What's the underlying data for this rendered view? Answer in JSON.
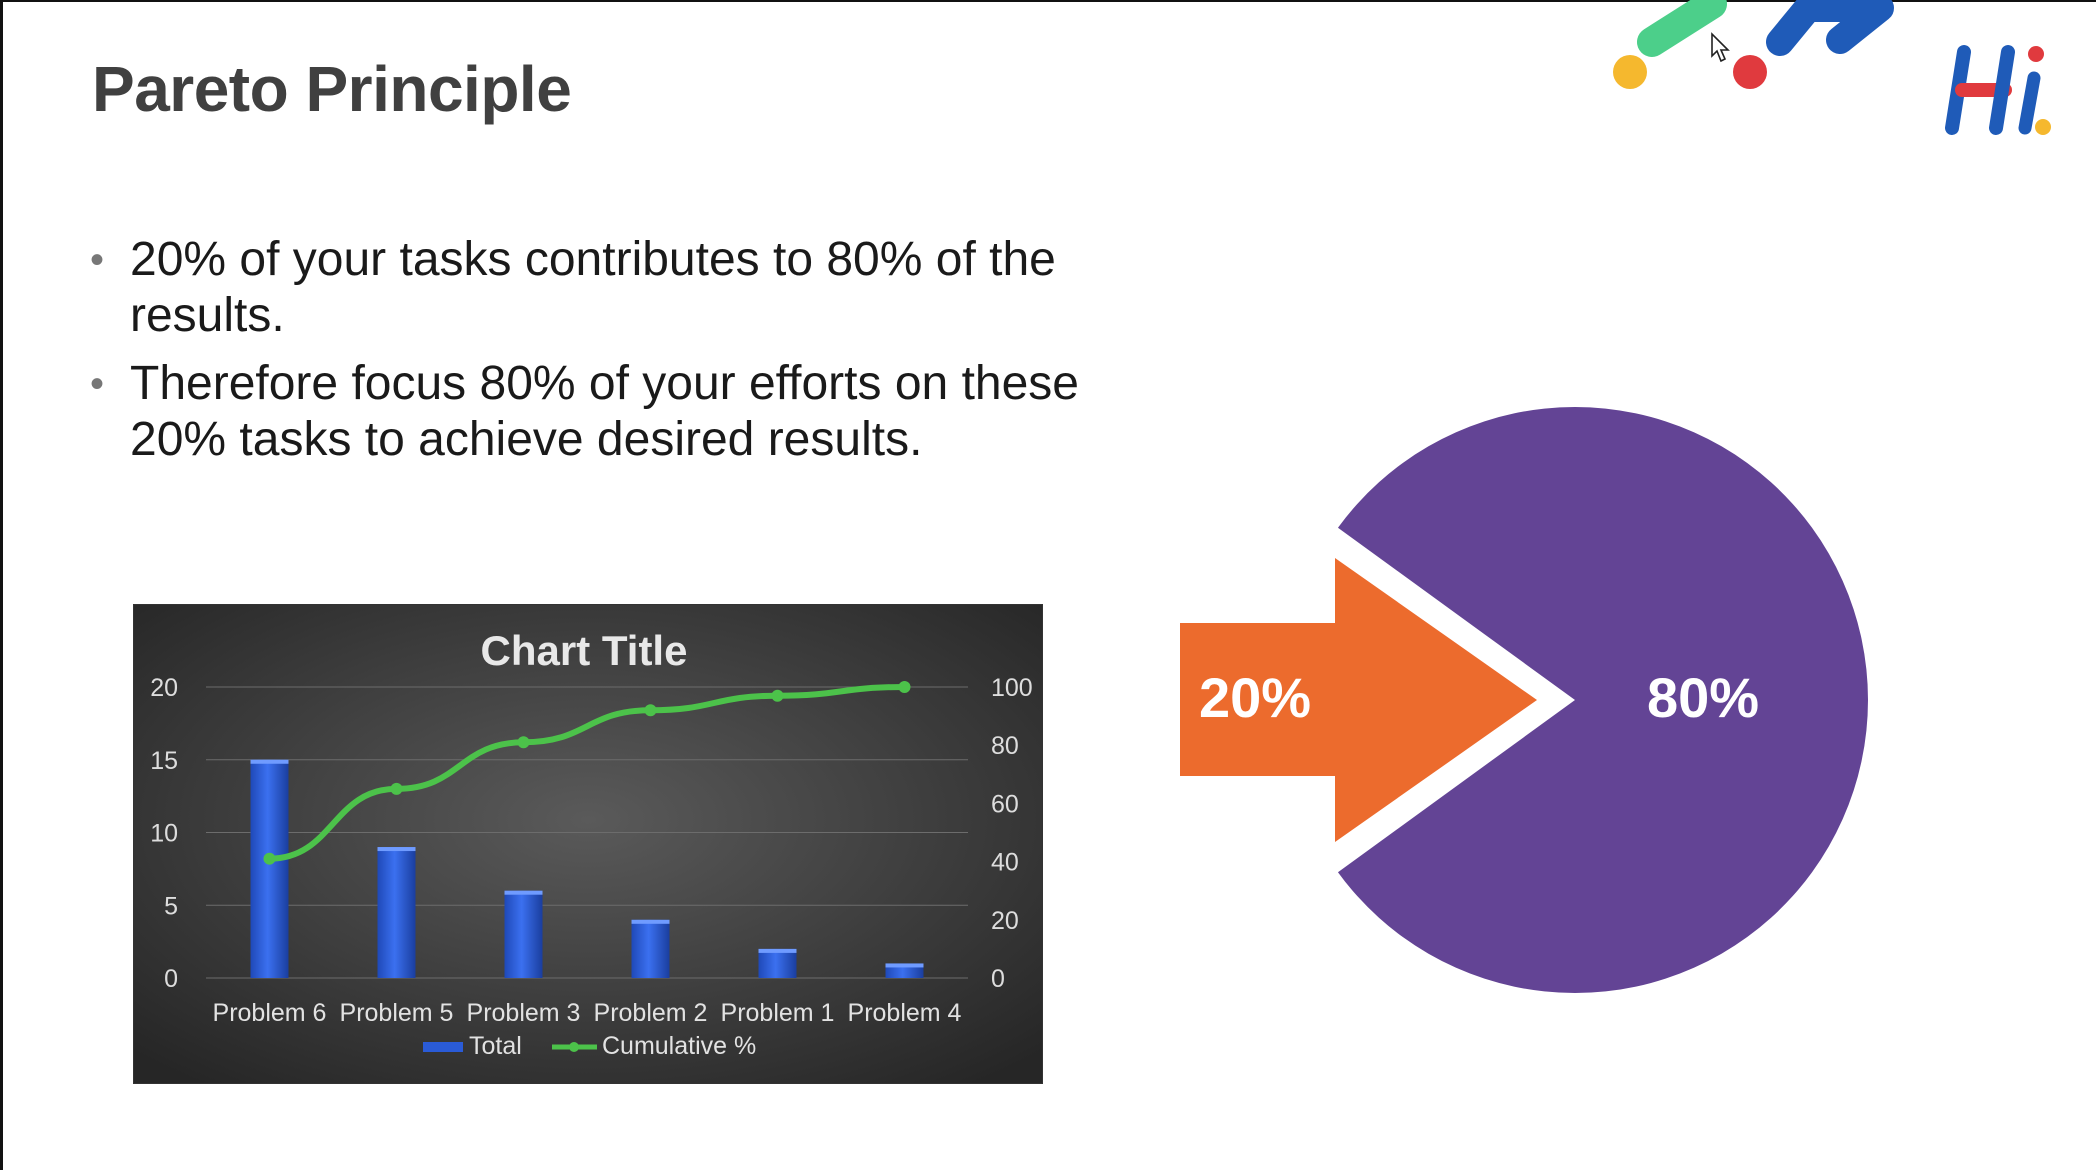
{
  "slide": {
    "title": "Pareto Principle",
    "bullets": [
      "20% of your tasks contributes to 80% of the results.",
      "Therefore focus 80% of your efforts on these 20% tasks to achieve desired results."
    ]
  },
  "chart_data": [
    {
      "type": "bar",
      "title": "Chart Title",
      "categories": [
        "Problem 6",
        "Problem 5",
        "Problem 3",
        "Problem 2",
        "Problem 1",
        "Problem 4"
      ],
      "series": [
        {
          "name": "Total",
          "type": "bar",
          "axis": "left",
          "values": [
            15,
            9,
            6,
            4,
            2,
            1
          ],
          "color": "#2a5bd7"
        },
        {
          "name": "Cumulative %",
          "type": "line",
          "axis": "right",
          "values": [
            41,
            65,
            81,
            92,
            97,
            100
          ],
          "color": "#4cc24a"
        }
      ],
      "ylim": [
        0,
        20
      ],
      "yticks": [
        "0",
        "5",
        "10",
        "15",
        "20"
      ],
      "y2lim": [
        0,
        100
      ],
      "y2ticks": [
        "0",
        "20",
        "40",
        "60",
        "80",
        "100"
      ],
      "legend_position": "bottom",
      "grid": true,
      "background": "#2f2f2f"
    },
    {
      "type": "pie",
      "slices": [
        {
          "label": "20%",
          "value": 20,
          "color": "#ec6b2d"
        },
        {
          "label": "80%",
          "value": 80,
          "color": "#634495"
        }
      ]
    }
  ],
  "branding": {
    "logo_letters": "Hi",
    "colors": {
      "blue": "#1f5bb8",
      "red": "#e03a3e",
      "yellow": "#f5b82e",
      "green": "#4ccf8a"
    }
  },
  "icons": {
    "cursor": "mouse-pointer-icon"
  }
}
